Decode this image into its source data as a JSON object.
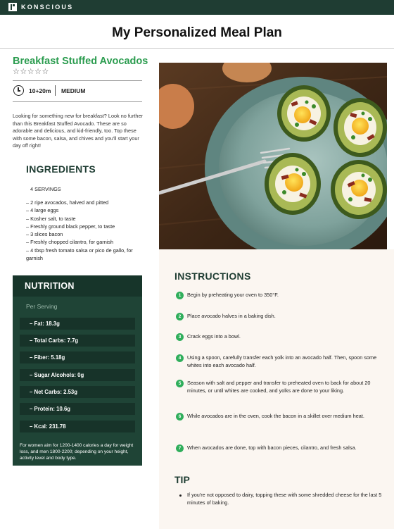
{
  "brand": {
    "name": "KONSCIOUS"
  },
  "page": {
    "title": "My Personalized Meal Plan"
  },
  "recipe": {
    "title": "Breakfast Stuffed Avocados",
    "rating": {
      "value": 0,
      "max": 5
    },
    "time": "10+20m",
    "difficulty": "MEDIUM",
    "intro": "Looking for something new for breakfast? Look no further than this Breakfast Stuffed Avocado. These are so adorable and delicious, and kid-friendly, too. Top these with some bacon, salsa, and chives and you'll start your day off right!"
  },
  "ingredients": {
    "heading": "INGREDIENTS",
    "servings": "4 SERVINGS",
    "items": [
      "– 2 ripe avocados, halved and pitted",
      "– 4 large eggs",
      "– Kosher salt, to taste",
      "– Freshly ground black pepper, to taste",
      "– 3 slices bacon",
      "– Freshly chopped cilantro,  for garnish",
      "– 4 tbsp fresh tomato salsa or pico de gallo, for garnish"
    ]
  },
  "nutrition": {
    "heading": "NUTRITION",
    "per_serving": "Per Serving",
    "rows": [
      "– Fat: 18.3g",
      "– Total Carbs: 7.7g",
      "– Fiber: 5.18g",
      "– Sugar Alcohols: 0g",
      "– Net Carbs: 2.53g",
      "– Protein: 10.6g",
      "– Kcal: 231.78"
    ],
    "note": "For women aim for 1200-1400 calories a day for weight loss, and men 1800-2200; depending on your height, activity level and body type."
  },
  "instructions": {
    "heading": "INSTRUCTIONS",
    "steps": [
      {
        "num": "1",
        "text": "Begin by preheating your oven to 350°F."
      },
      {
        "num": "2",
        "text": "Place avocado halves in a baking dish."
      },
      {
        "num": "3",
        "text": "Crack eggs into a bowl."
      },
      {
        "num": "4",
        "text": "Using a spoon, carefully transfer each yolk into an avocado half. Then, spoon some whites into each avocado half."
      },
      {
        "num": "5",
        "text": "Season with salt and pepper and transfer to preheated oven to back for about 20 minutes, or until whites are cooked, and yolks are done to your liking."
      },
      {
        "num": "6",
        "text": "While avocados are in the oven, cook the bacon in a skillet over medium heat."
      },
      {
        "num": "7",
        "text": "When avocados are done, top with bacon pieces, cilantro, and fresh salsa."
      }
    ]
  },
  "tip": {
    "heading": "TIP",
    "text": "If you're not opposed to dairy, topping these with some shredded cheese for the last 5 minutes of baking."
  },
  "colors": {
    "brand_dark": "#1f3d33",
    "accent_green": "#2b9c4f",
    "step_green": "#2fae5b",
    "nutrition_bg": "#1f4436",
    "instructions_bg": "#fbf6f1"
  },
  "image": {
    "subject": "stuffed-avocados-photo"
  }
}
